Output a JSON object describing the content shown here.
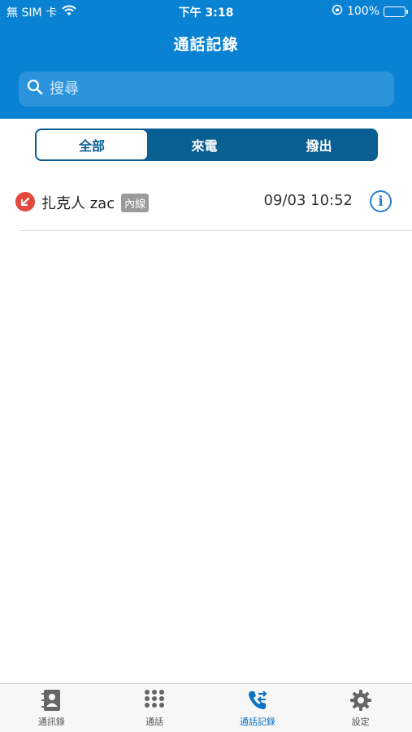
{
  "status": {
    "carrier": "無 SIM 卡",
    "time": "下午 3:18",
    "battery": "100%"
  },
  "nav": {
    "title": "通話記錄"
  },
  "search": {
    "placeholder": "搜尋"
  },
  "segments": [
    {
      "label": "全部",
      "active": true
    },
    {
      "label": "來電",
      "active": false
    },
    {
      "label": "撥出",
      "active": false
    }
  ],
  "calls": [
    {
      "name": "扎克人 zac",
      "badge": "內線",
      "datetime": "09/03 10:52",
      "direction": "incoming"
    }
  ],
  "tabs": [
    {
      "label": "通訊錄",
      "icon": "contacts-icon"
    },
    {
      "label": "通話",
      "icon": "dialpad-icon"
    },
    {
      "label": "通話記錄",
      "icon": "call-log-icon",
      "active": true
    },
    {
      "label": "設定",
      "icon": "gear-icon"
    }
  ],
  "colors": {
    "primary": "#0a82d4",
    "segment": "#0a5f92",
    "incoming": "#e2483d",
    "accent": "#2a7fd0"
  }
}
